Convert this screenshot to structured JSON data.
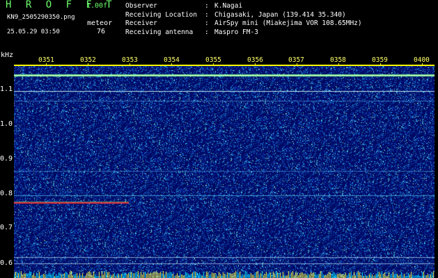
{
  "header": {
    "brand": "H R O F F T",
    "version": "1.00f",
    "filename": "KN9_2505290350.png",
    "meteor_label": "meteor",
    "datetime": "25.05.29 03:50",
    "meteor_count": "76"
  },
  "meta": [
    {
      "key": "Observer",
      "value": "K.Nagai"
    },
    {
      "key": "Receiving Location",
      "value": "Chigasaki, Japan (139.414 35.340)"
    },
    {
      "key": "Receiver",
      "value": "AirSpy mini (Miakejima VOR 108.65MHz)"
    },
    {
      "key": "Receiving antenna",
      "value": "Maspro FM-3"
    }
  ],
  "axis": {
    "unit": "kHz",
    "y_ticks": [
      "1.1",
      "1.0",
      "0.9",
      "0.8",
      "0.7",
      "0.6"
    ],
    "x_ticks": [
      "0351",
      "0352",
      "0353",
      "0354",
      "0355",
      "0356",
      "0357",
      "0358",
      "0359",
      "0400"
    ]
  },
  "colors": {
    "background": "#000000",
    "noise_base": "#00108a",
    "signal": "#ffffff",
    "meteor": "#ff2020",
    "axis": "#ffff00"
  }
}
